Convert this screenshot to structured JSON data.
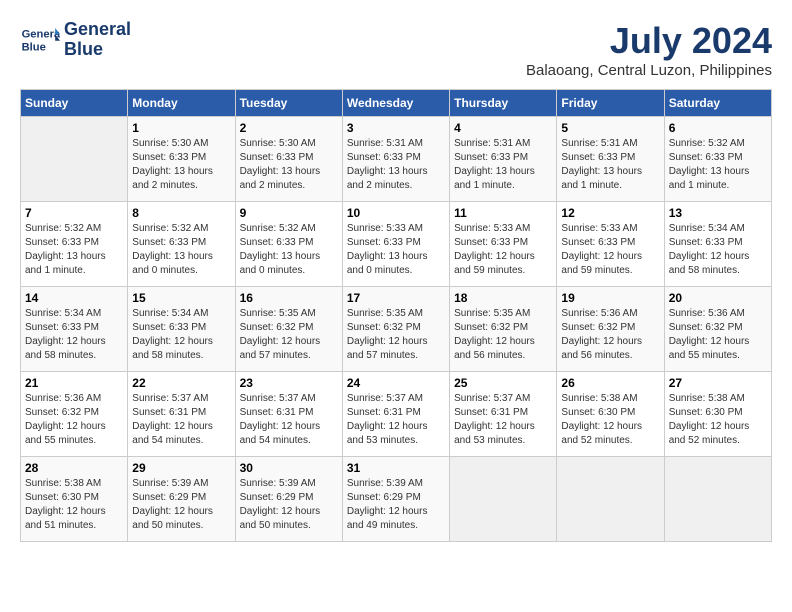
{
  "header": {
    "logo_line1": "General",
    "logo_line2": "Blue",
    "month_title": "July 2024",
    "location": "Balaoang, Central Luzon, Philippines"
  },
  "weekdays": [
    "Sunday",
    "Monday",
    "Tuesday",
    "Wednesday",
    "Thursday",
    "Friday",
    "Saturday"
  ],
  "weeks": [
    [
      {
        "day": "",
        "sunrise": "",
        "sunset": "",
        "daylight": ""
      },
      {
        "day": "1",
        "sunrise": "Sunrise: 5:30 AM",
        "sunset": "Sunset: 6:33 PM",
        "daylight": "Daylight: 13 hours and 2 minutes."
      },
      {
        "day": "2",
        "sunrise": "Sunrise: 5:30 AM",
        "sunset": "Sunset: 6:33 PM",
        "daylight": "Daylight: 13 hours and 2 minutes."
      },
      {
        "day": "3",
        "sunrise": "Sunrise: 5:31 AM",
        "sunset": "Sunset: 6:33 PM",
        "daylight": "Daylight: 13 hours and 2 minutes."
      },
      {
        "day": "4",
        "sunrise": "Sunrise: 5:31 AM",
        "sunset": "Sunset: 6:33 PM",
        "daylight": "Daylight: 13 hours and 1 minute."
      },
      {
        "day": "5",
        "sunrise": "Sunrise: 5:31 AM",
        "sunset": "Sunset: 6:33 PM",
        "daylight": "Daylight: 13 hours and 1 minute."
      },
      {
        "day": "6",
        "sunrise": "Sunrise: 5:32 AM",
        "sunset": "Sunset: 6:33 PM",
        "daylight": "Daylight: 13 hours and 1 minute."
      }
    ],
    [
      {
        "day": "7",
        "sunrise": "Sunrise: 5:32 AM",
        "sunset": "Sunset: 6:33 PM",
        "daylight": "Daylight: 13 hours and 1 minute."
      },
      {
        "day": "8",
        "sunrise": "Sunrise: 5:32 AM",
        "sunset": "Sunset: 6:33 PM",
        "daylight": "Daylight: 13 hours and 0 minutes."
      },
      {
        "day": "9",
        "sunrise": "Sunrise: 5:32 AM",
        "sunset": "Sunset: 6:33 PM",
        "daylight": "Daylight: 13 hours and 0 minutes."
      },
      {
        "day": "10",
        "sunrise": "Sunrise: 5:33 AM",
        "sunset": "Sunset: 6:33 PM",
        "daylight": "Daylight: 13 hours and 0 minutes."
      },
      {
        "day": "11",
        "sunrise": "Sunrise: 5:33 AM",
        "sunset": "Sunset: 6:33 PM",
        "daylight": "Daylight: 12 hours and 59 minutes."
      },
      {
        "day": "12",
        "sunrise": "Sunrise: 5:33 AM",
        "sunset": "Sunset: 6:33 PM",
        "daylight": "Daylight: 12 hours and 59 minutes."
      },
      {
        "day": "13",
        "sunrise": "Sunrise: 5:34 AM",
        "sunset": "Sunset: 6:33 PM",
        "daylight": "Daylight: 12 hours and 58 minutes."
      }
    ],
    [
      {
        "day": "14",
        "sunrise": "Sunrise: 5:34 AM",
        "sunset": "Sunset: 6:33 PM",
        "daylight": "Daylight: 12 hours and 58 minutes."
      },
      {
        "day": "15",
        "sunrise": "Sunrise: 5:34 AM",
        "sunset": "Sunset: 6:33 PM",
        "daylight": "Daylight: 12 hours and 58 minutes."
      },
      {
        "day": "16",
        "sunrise": "Sunrise: 5:35 AM",
        "sunset": "Sunset: 6:32 PM",
        "daylight": "Daylight: 12 hours and 57 minutes."
      },
      {
        "day": "17",
        "sunrise": "Sunrise: 5:35 AM",
        "sunset": "Sunset: 6:32 PM",
        "daylight": "Daylight: 12 hours and 57 minutes."
      },
      {
        "day": "18",
        "sunrise": "Sunrise: 5:35 AM",
        "sunset": "Sunset: 6:32 PM",
        "daylight": "Daylight: 12 hours and 56 minutes."
      },
      {
        "day": "19",
        "sunrise": "Sunrise: 5:36 AM",
        "sunset": "Sunset: 6:32 PM",
        "daylight": "Daylight: 12 hours and 56 minutes."
      },
      {
        "day": "20",
        "sunrise": "Sunrise: 5:36 AM",
        "sunset": "Sunset: 6:32 PM",
        "daylight": "Daylight: 12 hours and 55 minutes."
      }
    ],
    [
      {
        "day": "21",
        "sunrise": "Sunrise: 5:36 AM",
        "sunset": "Sunset: 6:32 PM",
        "daylight": "Daylight: 12 hours and 55 minutes."
      },
      {
        "day": "22",
        "sunrise": "Sunrise: 5:37 AM",
        "sunset": "Sunset: 6:31 PM",
        "daylight": "Daylight: 12 hours and 54 minutes."
      },
      {
        "day": "23",
        "sunrise": "Sunrise: 5:37 AM",
        "sunset": "Sunset: 6:31 PM",
        "daylight": "Daylight: 12 hours and 54 minutes."
      },
      {
        "day": "24",
        "sunrise": "Sunrise: 5:37 AM",
        "sunset": "Sunset: 6:31 PM",
        "daylight": "Daylight: 12 hours and 53 minutes."
      },
      {
        "day": "25",
        "sunrise": "Sunrise: 5:37 AM",
        "sunset": "Sunset: 6:31 PM",
        "daylight": "Daylight: 12 hours and 53 minutes."
      },
      {
        "day": "26",
        "sunrise": "Sunrise: 5:38 AM",
        "sunset": "Sunset: 6:30 PM",
        "daylight": "Daylight: 12 hours and 52 minutes."
      },
      {
        "day": "27",
        "sunrise": "Sunrise: 5:38 AM",
        "sunset": "Sunset: 6:30 PM",
        "daylight": "Daylight: 12 hours and 52 minutes."
      }
    ],
    [
      {
        "day": "28",
        "sunrise": "Sunrise: 5:38 AM",
        "sunset": "Sunset: 6:30 PM",
        "daylight": "Daylight: 12 hours and 51 minutes."
      },
      {
        "day": "29",
        "sunrise": "Sunrise: 5:39 AM",
        "sunset": "Sunset: 6:29 PM",
        "daylight": "Daylight: 12 hours and 50 minutes."
      },
      {
        "day": "30",
        "sunrise": "Sunrise: 5:39 AM",
        "sunset": "Sunset: 6:29 PM",
        "daylight": "Daylight: 12 hours and 50 minutes."
      },
      {
        "day": "31",
        "sunrise": "Sunrise: 5:39 AM",
        "sunset": "Sunset: 6:29 PM",
        "daylight": "Daylight: 12 hours and 49 minutes."
      },
      {
        "day": "",
        "sunrise": "",
        "sunset": "",
        "daylight": ""
      },
      {
        "day": "",
        "sunrise": "",
        "sunset": "",
        "daylight": ""
      },
      {
        "day": "",
        "sunrise": "",
        "sunset": "",
        "daylight": ""
      }
    ]
  ]
}
